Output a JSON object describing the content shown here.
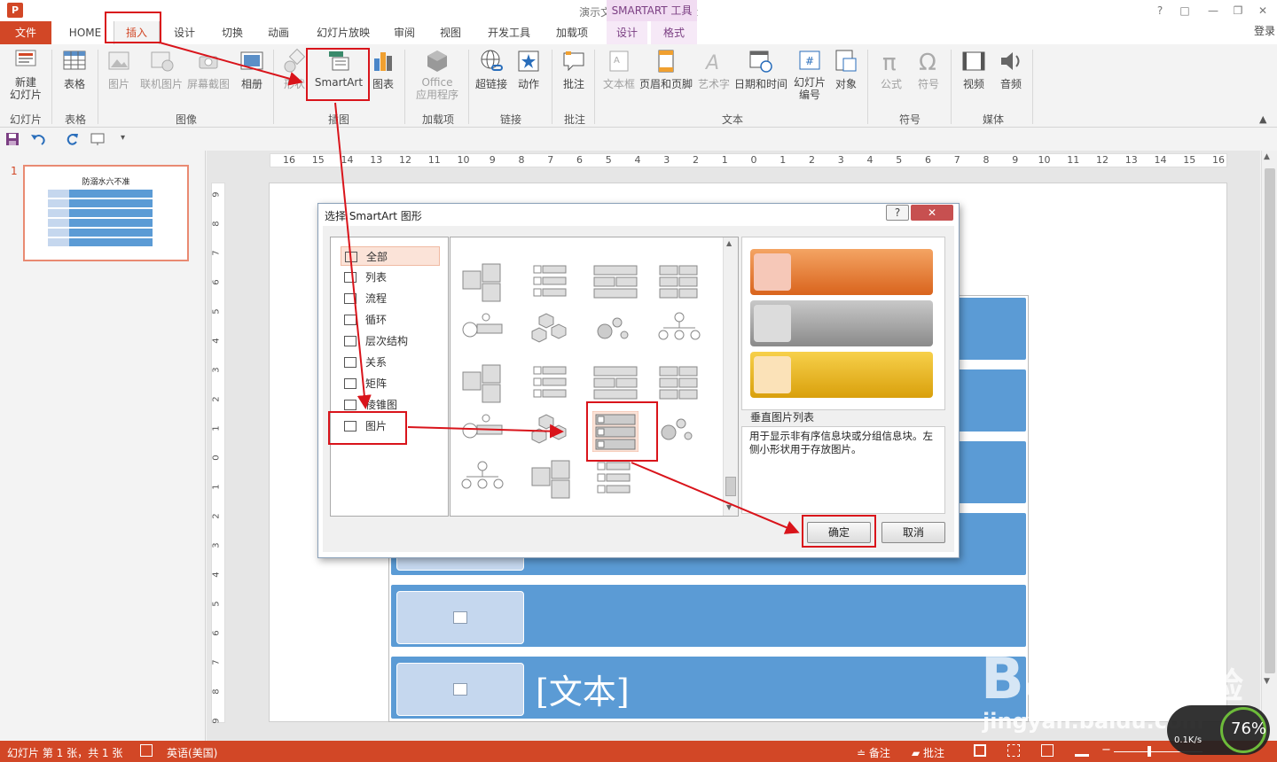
{
  "window": {
    "title": "演示文稿1 - PowerPoint",
    "app_icon": "P",
    "help": "?",
    "restore": "□",
    "minimize": "—",
    "maximize": "❐",
    "close": "✕"
  },
  "context_tools": "SMARTART 工具",
  "tabs": {
    "file": "文件",
    "home": "HOME",
    "insert": "插入",
    "design": "设计",
    "transitions": "切换",
    "animations": "动画",
    "slideshow": "幻灯片放映",
    "review": "审阅",
    "view": "视图",
    "developer": "开发工具",
    "addins": "加载项",
    "sa_design": "设计",
    "sa_format": "格式",
    "login": "登录"
  },
  "ribbon": {
    "new_slide": "新建\n幻灯片",
    "table": "表格",
    "picture": "图片",
    "online_picture": "联机图片",
    "screenshot": "屏幕截图",
    "album": "相册",
    "shapes": "形状",
    "smartart": "SmartArt",
    "chart": "图表",
    "office_apps_1": "Office",
    "office_apps_2": "应用程序",
    "hyperlink": "超链接",
    "action": "动作",
    "comment": "批注",
    "textbox": "文本框",
    "header_footer": "页眉和页脚",
    "wordart": "艺术字",
    "datetime": "日期和时间",
    "slide_number_1": "幻灯片",
    "slide_number_2": "编号",
    "object": "对象",
    "equation": "公式",
    "symbol": "符号",
    "video": "视频",
    "audio": "音频",
    "groups": {
      "slides": "幻灯片",
      "tables": "表格",
      "images": "图像",
      "illustrations": "插图",
      "addins": "加载项",
      "links": "链接",
      "comments": "批注",
      "text": "文本",
      "symbols": "符号",
      "media": "媒体"
    }
  },
  "thumbnail": {
    "number": "1",
    "title": "防溺水六不准"
  },
  "ruler_h": [
    "16",
    "15",
    "14",
    "13",
    "12",
    "11",
    "10",
    "9",
    "8",
    "7",
    "6",
    "5",
    "4",
    "3",
    "2",
    "1",
    "0",
    "1",
    "2",
    "3",
    "4",
    "5",
    "6",
    "7",
    "8",
    "9",
    "10",
    "11",
    "12",
    "13",
    "14",
    "15",
    "16"
  ],
  "ruler_v": [
    "9",
    "8",
    "7",
    "6",
    "5",
    "4",
    "3",
    "2",
    "1",
    "0",
    "1",
    "2",
    "3",
    "4",
    "5",
    "6",
    "7",
    "8",
    "9"
  ],
  "slide": {
    "placeholder_text": "[文本]"
  },
  "dialog": {
    "title": "选择 SmartArt 图形",
    "help": "?",
    "close": "✕",
    "categories": [
      "全部",
      "列表",
      "流程",
      "循环",
      "层次结构",
      "关系",
      "矩阵",
      "棱锥图",
      "图片"
    ],
    "preview_name": "垂直图片列表",
    "preview_desc": "用于显示非有序信息块或分组信息块。左侧小形状用于存放图片。",
    "ok": "确定",
    "cancel": "取消"
  },
  "statusbar": {
    "slide_info": "幻灯片 第 1 张，共 1 张",
    "language": "英语(美国)",
    "notes": "备注",
    "comments": "批注",
    "zoom_minus": "−",
    "zoom_plus": "+"
  },
  "watermark": {
    "brand": "Bai",
    "brand2": "du",
    "brand3": "经验",
    "url": "jingyan.baidu.com"
  },
  "speed_widget": {
    "percent": "76%",
    "rate": "0.1K/s"
  },
  "colors": {
    "accent": "#d24726",
    "smartart_blue": "#5b9bd5",
    "highlight": "#d9141b"
  }
}
